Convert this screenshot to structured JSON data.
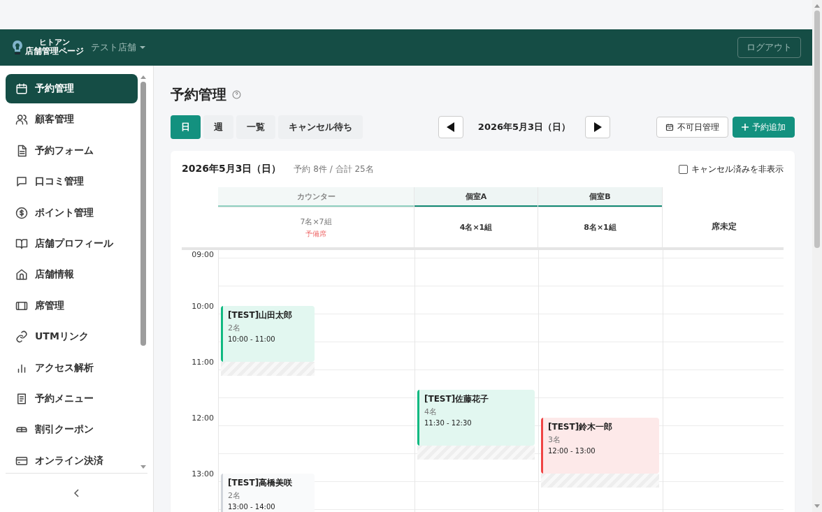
{
  "header": {
    "logo": {
      "line_1": "ヒトアン",
      "line_2": "店舗管理ページ"
    },
    "store_selector": "テスト店舗",
    "logout": "ログアウト"
  },
  "sidebar": {
    "items": [
      {
        "label": "予約管理",
        "selected": true
      },
      {
        "label": "顧客管理",
        "selected": false
      },
      {
        "label": "予約フォーム",
        "selected": false
      },
      {
        "label": "口コミ管理",
        "selected": false
      },
      {
        "label": "ポイント管理",
        "selected": false
      },
      {
        "label": "店舗プロフィール",
        "selected": false
      },
      {
        "label": "店舗情報",
        "selected": false
      },
      {
        "label": "席管理",
        "selected": false
      },
      {
        "label": "UTMリンク",
        "selected": false
      },
      {
        "label": "アクセス解析",
        "selected": false
      },
      {
        "label": "予約メニュー",
        "selected": false
      },
      {
        "label": "割引クーポン",
        "selected": false
      },
      {
        "label": "オンライン決済",
        "selected": false
      }
    ]
  },
  "page": {
    "title": "予約管理",
    "view_tabs": [
      {
        "label": "日",
        "selected": true
      },
      {
        "label": "週",
        "selected": false
      },
      {
        "label": "一覧",
        "selected": false
      },
      {
        "label": "キャンセル待ち",
        "selected": false
      }
    ],
    "date_nav": {
      "date": "2026年5月3日（日）"
    },
    "actions": [
      {
        "kind": "outline",
        "label": "不可日管理"
      },
      {
        "kind": "primary",
        "label": "予約追加"
      }
    ]
  },
  "schedule": {
    "date": "2026年5月3日（日）",
    "summary": "予約 8件 / 合計 25名",
    "hide_cancelled": {
      "label": "キャンセル済みを非表示",
      "checked": false
    },
    "times": [
      "09:00",
      "10:00",
      "11:00",
      "12:00",
      "13:00"
    ],
    "columns": [
      {
        "kind": "counter",
        "name": "カウンター",
        "capacity": "7名×7組",
        "note": "予備席",
        "reservations": [
          {
            "name": "[TEST]山田太郎",
            "party": "2名",
            "time": "10:00 - 11:00",
            "color": "#10b981"
          },
          {
            "name": "[TEST]高橋美咲",
            "party": "2名",
            "time": "13:00 - 14:00",
            "color": "#d1d5db"
          }
        ]
      },
      {
        "kind": "room",
        "name": "個室A",
        "capacity": "4名×1組",
        "reservations": [
          {
            "name": "[TEST]佐藤花子",
            "party": "4名",
            "time": "11:30 - 12:30",
            "color": "#10b981"
          }
        ]
      },
      {
        "kind": "room",
        "name": "個室B",
        "capacity": "8名×1組",
        "reservations": [
          {
            "name": "[TEST]鈴木一郎",
            "party": "3名",
            "time": "12:00 - 13:00",
            "color": "#ef4444"
          }
        ]
      },
      {
        "kind": "unassigned",
        "name": "席未定"
      }
    ]
  }
}
